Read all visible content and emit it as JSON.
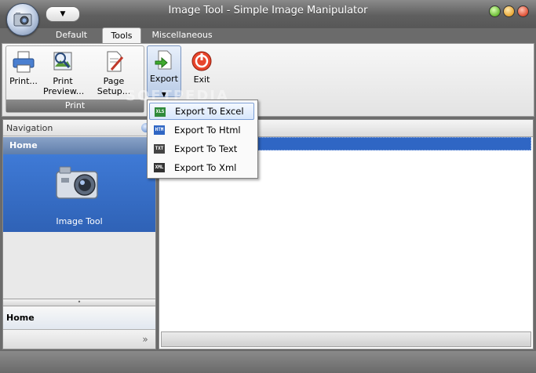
{
  "window": {
    "title": "Image Tool - Simple Image Manipulator",
    "qat_symbol": "▼"
  },
  "tabs": [
    {
      "label": "Default"
    },
    {
      "label": "Tools"
    },
    {
      "label": "Miscellaneous"
    }
  ],
  "ribbon": {
    "print_group": {
      "label": "Print",
      "buttons": [
        {
          "label": "Print..."
        },
        {
          "label": "Print Preview..."
        },
        {
          "label": "Page Setup..."
        }
      ]
    },
    "export_button": {
      "label": "Export",
      "arrow": "▼"
    },
    "exit_button": {
      "label": "Exit"
    }
  },
  "export_menu": {
    "items": [
      {
        "label": "Export To Excel",
        "badge": "XLS"
      },
      {
        "label": "Export To Html",
        "badge": "HTM"
      },
      {
        "label": "Export To Text",
        "badge": "TXT"
      },
      {
        "label": "Export To Xml",
        "badge": "XML"
      }
    ]
  },
  "navigation": {
    "header": "Navigation",
    "home_bar": "Home",
    "selected_item": "Image Tool",
    "bottom_home": "Home",
    "more_symbol": "»",
    "splitter_grip": "•"
  },
  "watermark": "SOFTPEDIA",
  "colors": {
    "selection_blue": "#2f66c4",
    "nav_selected": "#3f7ad6",
    "menu_highlight_border": "#7da0d6"
  }
}
